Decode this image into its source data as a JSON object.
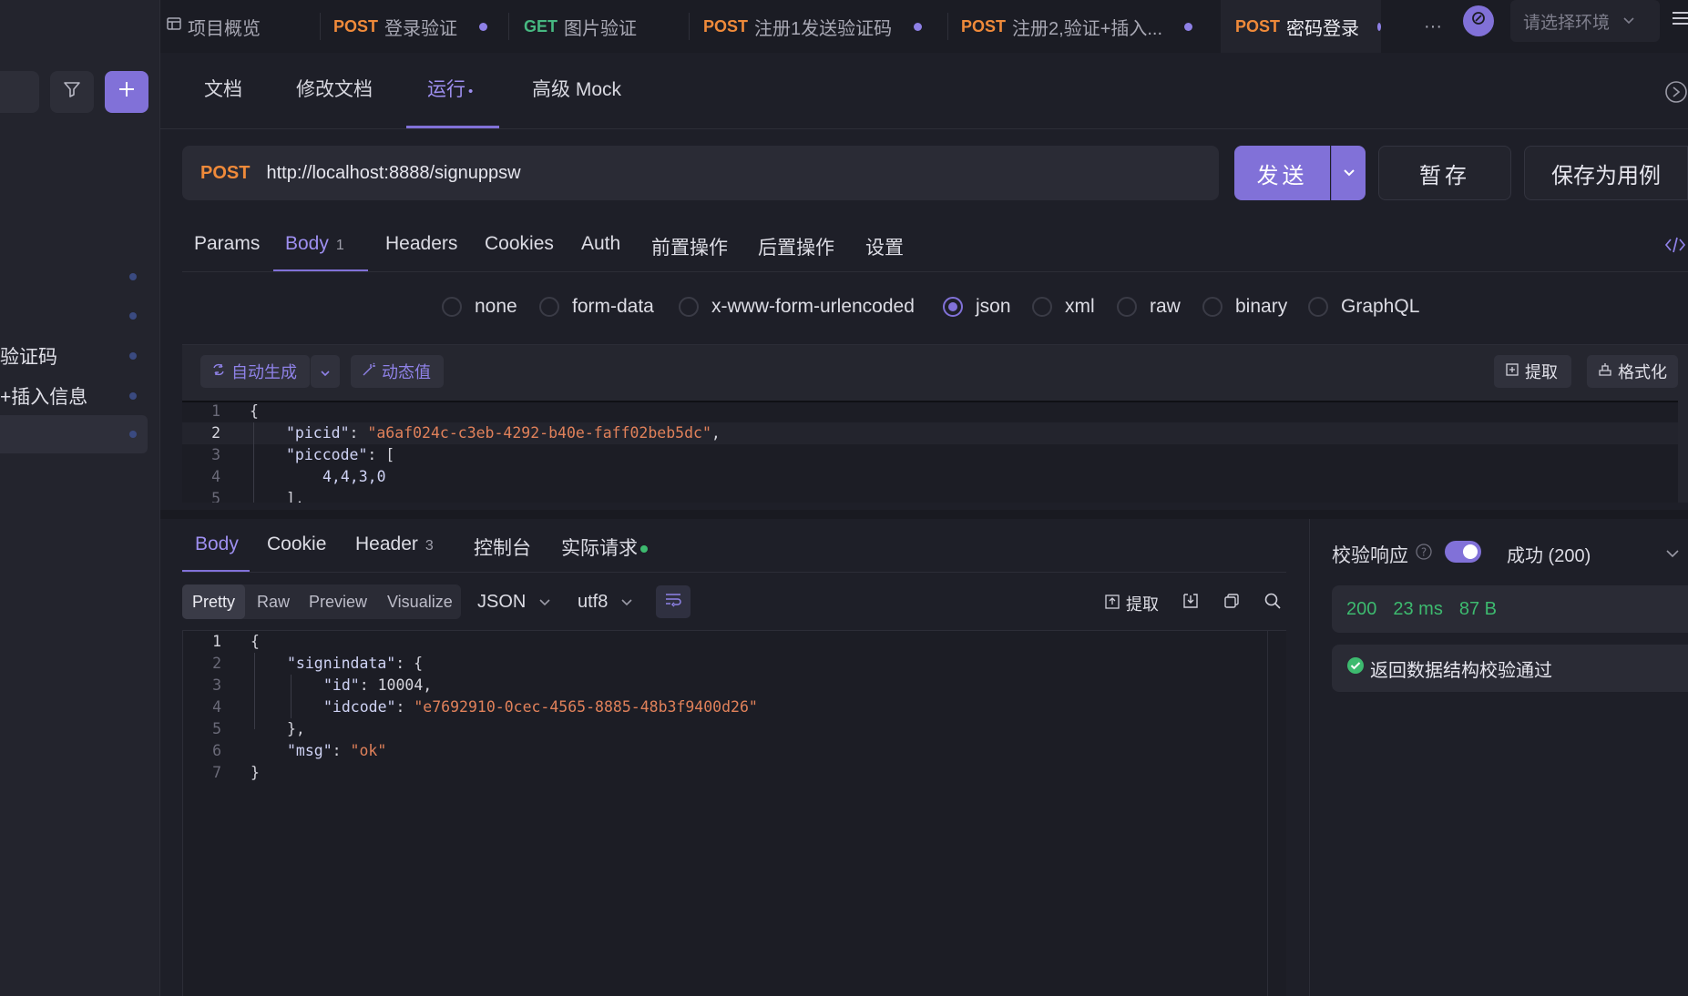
{
  "tabs": [
    {
      "method": "",
      "label": "项目概览"
    },
    {
      "method": "POST",
      "label": "登录验证"
    },
    {
      "method": "GET",
      "label": "图片验证"
    },
    {
      "method": "POST",
      "label": "注册1发送验证码"
    },
    {
      "method": "POST",
      "label": "注册2,验证+插入..."
    },
    {
      "method": "POST",
      "label": "密码登录"
    }
  ],
  "tabbar": {
    "more": "···",
    "env_placeholder": "请选择环境"
  },
  "sidebar": {
    "items": [
      {
        "label": ""
      },
      {
        "label": ""
      },
      {
        "label": "验证码"
      },
      {
        "label": "+插入信息"
      },
      {
        "label": ""
      }
    ]
  },
  "subnav": {
    "doc": "文档",
    "edit_doc": "修改文档",
    "run": "运行",
    "run_dot": "•",
    "mock": "高级 Mock"
  },
  "request": {
    "method": "POST",
    "url": "http://localhost:8888/signuppsw",
    "send": "发送",
    "save_temp": "暂存",
    "save_case": "保存为用例"
  },
  "req_tabs": {
    "params": "Params",
    "body": "Body",
    "body_count": "1",
    "headers": "Headers",
    "cookies": "Cookies",
    "auth": "Auth",
    "pre": "前置操作",
    "post": "后置操作",
    "settings": "设置"
  },
  "body_types": [
    "none",
    "form-data",
    "x-www-form-urlencoded",
    "json",
    "xml",
    "raw",
    "binary",
    "GraphQL"
  ],
  "body_type_selected": "json",
  "editor_toolbar": {
    "auto_gen": "自动生成",
    "dynamic": "动态值",
    "extract": "提取",
    "format": "格式化"
  },
  "request_body_lines": [
    {
      "n": "1",
      "text": "{"
    },
    {
      "n": "2",
      "key": "\"picid\"",
      "value": "\"a6af024c-c3eb-4292-b40e-faff02beb5dc\"",
      "end": ","
    },
    {
      "n": "3",
      "key": "\"piccode\"",
      "rest": ": ["
    },
    {
      "n": "4",
      "text": "4,4,3,0"
    },
    {
      "n": "5",
      "text": "],"
    }
  ],
  "response_tabs": {
    "body": "Body",
    "cookie": "Cookie",
    "header": "Header",
    "header_count": "3",
    "console": "控制台",
    "actual": "实际请求"
  },
  "response_view": {
    "pretty": "Pretty",
    "raw": "Raw",
    "preview": "Preview",
    "visualize": "Visualize",
    "format": "JSON",
    "encoding": "utf8",
    "extract": "提取"
  },
  "response_body_lines": [
    {
      "n": "1",
      "text": "{"
    },
    {
      "n": "2",
      "key": "\"signindata\"",
      "rest": ": {"
    },
    {
      "n": "3",
      "key": "\"id\"",
      "rest": ": 10004,"
    },
    {
      "n": "4",
      "key": "\"idcode\"",
      "rest": ": ",
      "value": "\"e7692910-0cec-4565-8885-48b3f9400d26\""
    },
    {
      "n": "5",
      "text": "},"
    },
    {
      "n": "6",
      "key": "\"msg\"",
      "rest": ": ",
      "value": "\"ok\""
    },
    {
      "n": "7",
      "text": "}"
    }
  ],
  "validation": {
    "title": "校验响应",
    "result": "成功 (200)",
    "status": "200",
    "time": "23 ms",
    "size": "87 B",
    "message": "返回数据结构校验通过"
  },
  "colors": {
    "accent": "#8171d8",
    "post": "#ef8a3a",
    "get": "#47b881",
    "success": "#3dba6f",
    "string": "#e0815a"
  }
}
